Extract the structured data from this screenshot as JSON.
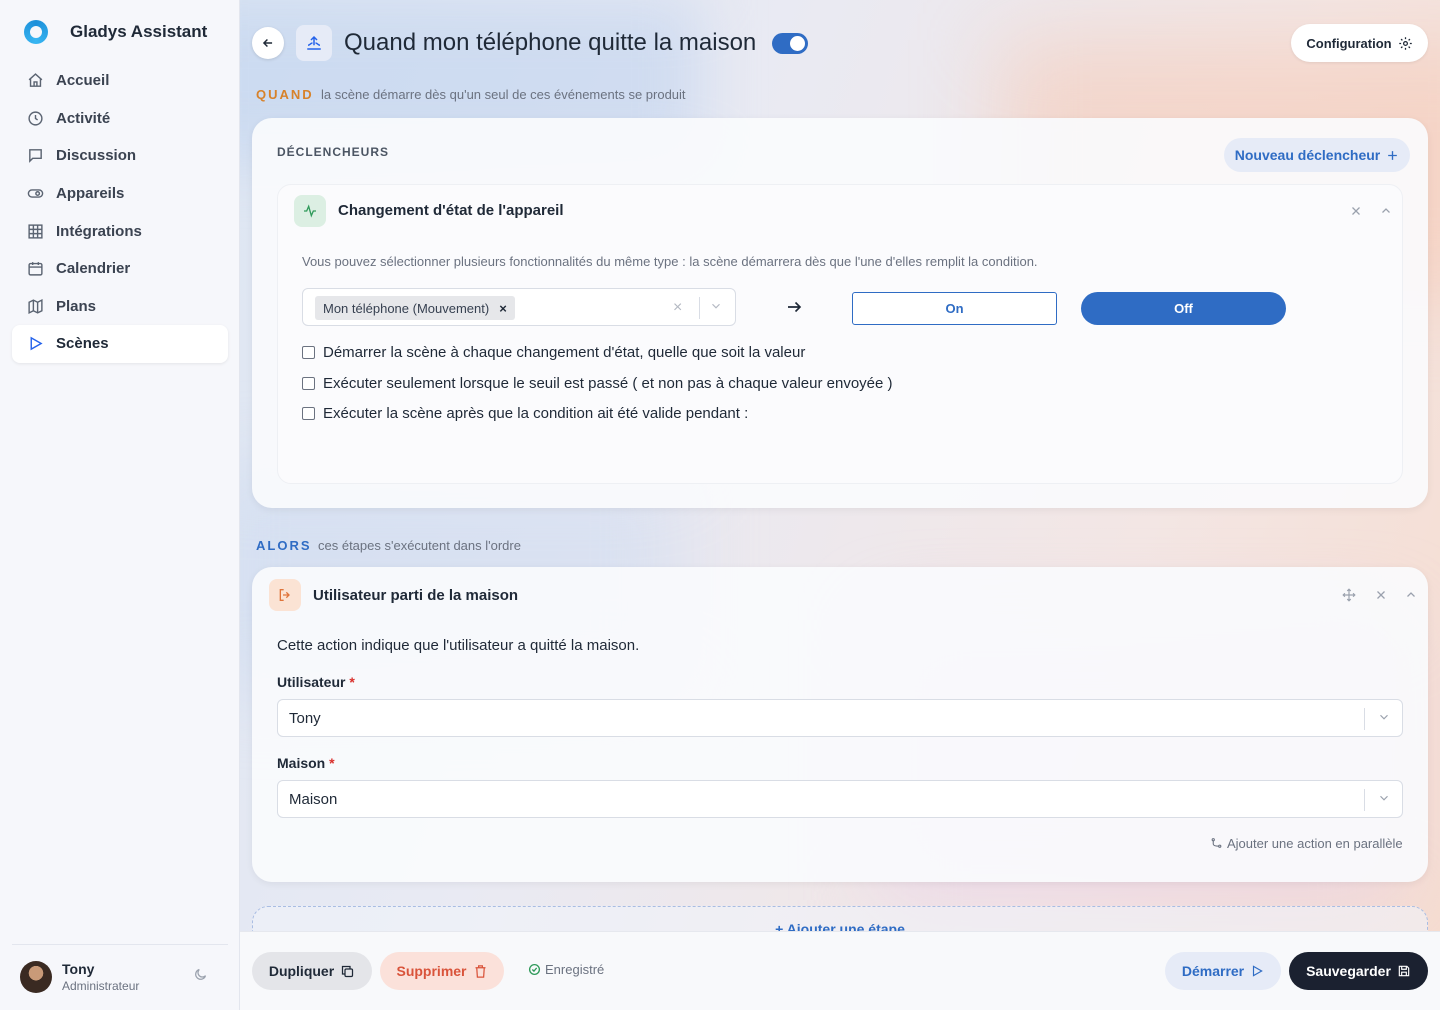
{
  "app": {
    "name": "Gladys Assistant"
  },
  "sidebar": {
    "items": [
      {
        "label": "Accueil",
        "icon": "home-icon"
      },
      {
        "label": "Activité",
        "icon": "clock-icon"
      },
      {
        "label": "Discussion",
        "icon": "chat-icon"
      },
      {
        "label": "Appareils",
        "icon": "toggle-icon"
      },
      {
        "label": "Intégrations",
        "icon": "grid-icon"
      },
      {
        "label": "Calendrier",
        "icon": "calendar-icon"
      },
      {
        "label": "Plans",
        "icon": "map-icon"
      },
      {
        "label": "Scènes",
        "icon": "play-icon",
        "active": true
      }
    ],
    "user": {
      "name": "Tony",
      "role": "Administrateur"
    }
  },
  "header": {
    "title": "Quand mon téléphone quitte la maison",
    "enabled": true,
    "config_label": "Configuration"
  },
  "quand": {
    "label": "QUAND",
    "subtitle": "la scène démarre dès qu'un seul de ces événements se produit",
    "card_title": "DÉCLENCHEURS",
    "new_trigger_label": "Nouveau déclencheur",
    "trigger": {
      "title": "Changement d'état de l'appareil",
      "hint": "Vous pouvez sélectionner plusieurs fonctionnalités du même type : la scène démarrera dès que l'une d'elles remplit la condition.",
      "selected_feature": "Mon téléphone (Mouvement)",
      "chip_remove": "×",
      "clear": "×",
      "on_label": "On",
      "off_label": "Off",
      "selected_value": "Off",
      "checkboxes": [
        {
          "label": "Démarrer la scène à chaque changement d'état, quelle que soit la valeur",
          "checked": false
        },
        {
          "label": "Exécuter seulement lorsque le seuil est passé ( et non pas à chaque valeur envoyée )",
          "checked": false
        },
        {
          "label": "Exécuter la scène après que la condition ait été valide pendant :",
          "checked": false
        }
      ]
    }
  },
  "alors": {
    "label": "ALORS",
    "subtitle": "ces étapes s'exécutent dans l'ordre",
    "action": {
      "title": "Utilisateur parti de la maison",
      "description": "Cette action indique que l'utilisateur a quitté la maison.",
      "user_label": "Utilisateur",
      "user_value": "Tony",
      "house_label": "Maison",
      "house_value": "Maison",
      "required_mark": "*",
      "parallel_label": "Ajouter une action en parallèle"
    },
    "add_step_label": "Ajouter une étape"
  },
  "footer": {
    "duplicate_label": "Dupliquer",
    "delete_label": "Supprimer",
    "saved_label": "Enregistré",
    "start_label": "Démarrer",
    "save_label": "Sauvegarder"
  },
  "colors": {
    "accent": "#2f6cc4",
    "quand": "#d7822a",
    "alors": "#2f6cc4",
    "danger": "#d9533a",
    "dark": "#1b2130"
  }
}
